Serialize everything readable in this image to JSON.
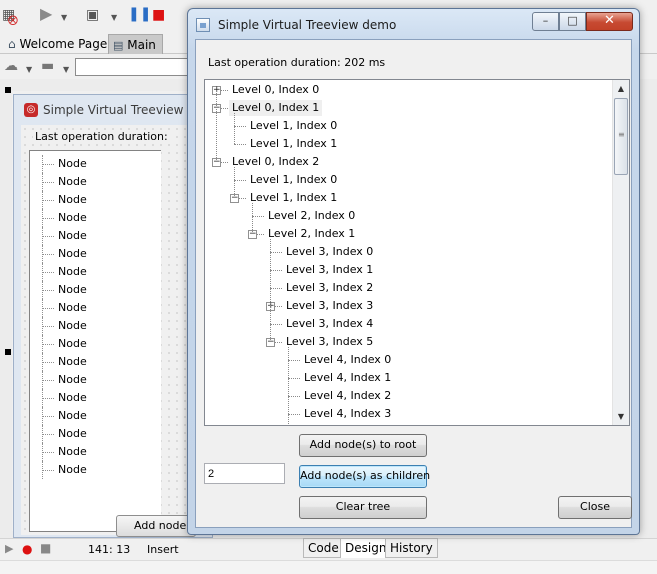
{
  "ide": {
    "tabs": [
      {
        "label": "Welcome Page"
      },
      {
        "label": "Main"
      }
    ],
    "form_title": "Simple Virtual Treeview demo",
    "design_duration_label": "Last operation duration:",
    "design_nodes": [
      "Node",
      "Node",
      "Node",
      "Node",
      "Node",
      "Node",
      "Node",
      "Node",
      "Node",
      "Node",
      "Node",
      "Node",
      "Node",
      "Node",
      "Node",
      "Node",
      "Node",
      "Node"
    ],
    "design_button_label": "Add node(s) to root",
    "status": {
      "position": "141: 13",
      "mode": "Insert"
    },
    "bottom_tabs": [
      "Code",
      "Design",
      "History"
    ],
    "selected_bottom_tab": "Design"
  },
  "window": {
    "title": "Simple Virtual Treeview demo",
    "duration": "Last operation duration: 202 ms",
    "tree": [
      {
        "label": "Level 0, Index 0",
        "level": 0,
        "expander": "plus"
      },
      {
        "label": "Level 0, Index 1",
        "level": 0,
        "expander": "minus",
        "selected": true
      },
      {
        "label": "Level 1, Index 0",
        "level": 1,
        "expander": "none"
      },
      {
        "label": "Level 1, Index 1",
        "level": 1,
        "expander": "none"
      },
      {
        "label": "Level 0, Index 2",
        "level": 0,
        "expander": "minus"
      },
      {
        "label": "Level 1, Index 0",
        "level": 1,
        "expander": "none"
      },
      {
        "label": "Level 1, Index 1",
        "level": 1,
        "expander": "minus"
      },
      {
        "label": "Level 2, Index 0",
        "level": 2,
        "expander": "none"
      },
      {
        "label": "Level 2, Index 1",
        "level": 2,
        "expander": "minus"
      },
      {
        "label": "Level 3, Index 0",
        "level": 3,
        "expander": "none"
      },
      {
        "label": "Level 3, Index 1",
        "level": 3,
        "expander": "none"
      },
      {
        "label": "Level 3, Index 2",
        "level": 3,
        "expander": "none"
      },
      {
        "label": "Level 3, Index 3",
        "level": 3,
        "expander": "plus"
      },
      {
        "label": "Level 3, Index 4",
        "level": 3,
        "expander": "none"
      },
      {
        "label": "Level 3, Index 5",
        "level": 3,
        "expander": "minus"
      },
      {
        "label": "Level 4, Index 0",
        "level": 4,
        "expander": "none"
      },
      {
        "label": "Level 4, Index 1",
        "level": 4,
        "expander": "none"
      },
      {
        "label": "Level 4, Index 2",
        "level": 4,
        "expander": "none"
      },
      {
        "label": "Level 4, Index 3",
        "level": 4,
        "expander": "none"
      }
    ],
    "buttons": {
      "add_root": "Add node(s) to root",
      "add_children": "Add node(s) as children",
      "clear_tree": "Clear tree",
      "close": "Close"
    },
    "count_value": "2",
    "caption": {
      "minimize": "–",
      "maximize": "□",
      "close": "✕"
    }
  },
  "icons": [
    "run-icon",
    "stop-icon",
    "pause-icon",
    "home-icon",
    "form-icon",
    "window-icon"
  ]
}
